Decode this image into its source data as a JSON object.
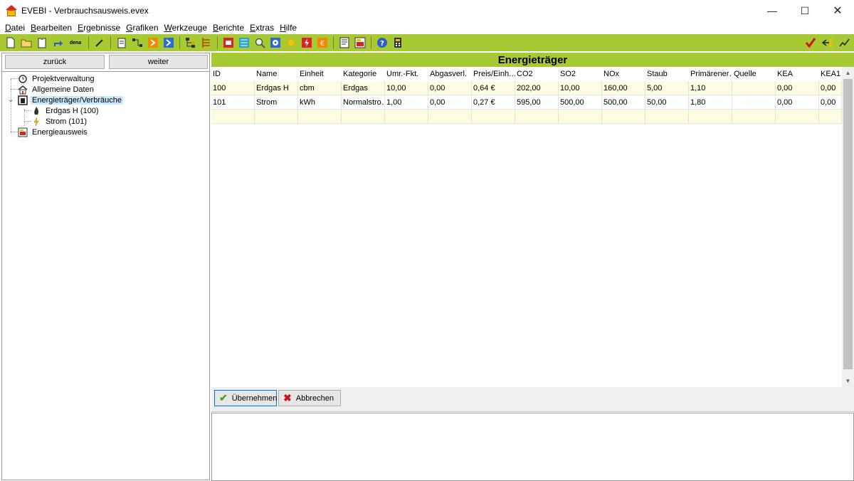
{
  "window": {
    "title": "EVEBI - Verbrauchsausweis.evex",
    "minimize_glyph": "—",
    "maximize_glyph": "☐",
    "close_glyph": "✕"
  },
  "menu": [
    "Datei",
    "Bearbeiten",
    "Ergebnisse",
    "Grafiken",
    "Werkzeuge",
    "Berichte",
    "Extras",
    "Hilfe"
  ],
  "toolbar": {
    "dena_label": "dena"
  },
  "nav": {
    "back_label": "zurück",
    "forward_label": "weiter"
  },
  "tree": {
    "items": [
      {
        "label": "Projektverwaltung",
        "icon": "gear-clock-icon"
      },
      {
        "label": "Allgemeine Daten",
        "icon": "house-icon"
      },
      {
        "label": "Energieträger/Verbräuche",
        "icon": "energy-meter-icon",
        "selected": true,
        "expanded": true
      },
      {
        "label": "Erdgas H (100)",
        "icon": "flame-icon"
      },
      {
        "label": "Strom (101)",
        "icon": "lightning-icon"
      },
      {
        "label": "Energieausweis",
        "icon": "certificate-icon"
      }
    ]
  },
  "panel": {
    "title": "Energieträger"
  },
  "grid": {
    "columns": [
      "ID",
      "Name",
      "Einheit",
      "Kategorie",
      "Umr.-Fkt.",
      "Abgasverl.",
      "Preis/Einh.…",
      "CO2",
      "SO2",
      "NOx",
      "Staub",
      "Primärener…",
      "Quelle",
      "KEA",
      "KEA1"
    ],
    "rows": [
      [
        "100",
        "Erdgas H",
        "cbm",
        "Erdgas",
        "10,00",
        "0,00",
        "0,64 €",
        "202,00",
        "10,00",
        "160,00",
        "5,00",
        "1,10",
        "",
        "0,00",
        "0,00"
      ],
      [
        "101",
        "Strom",
        "kWh",
        "Normalstro…",
        "1,00",
        "0,00",
        "0,27 €",
        "595,00",
        "500,00",
        "500,00",
        "50,00",
        "1,80",
        "",
        "0,00",
        "0,00"
      ]
    ]
  },
  "actions": {
    "apply_label": "Übernehmen",
    "cancel_label": "Abbrechen"
  },
  "colors": {
    "accent_green": "#a6c934",
    "row_highlight": "#fffbe3"
  }
}
